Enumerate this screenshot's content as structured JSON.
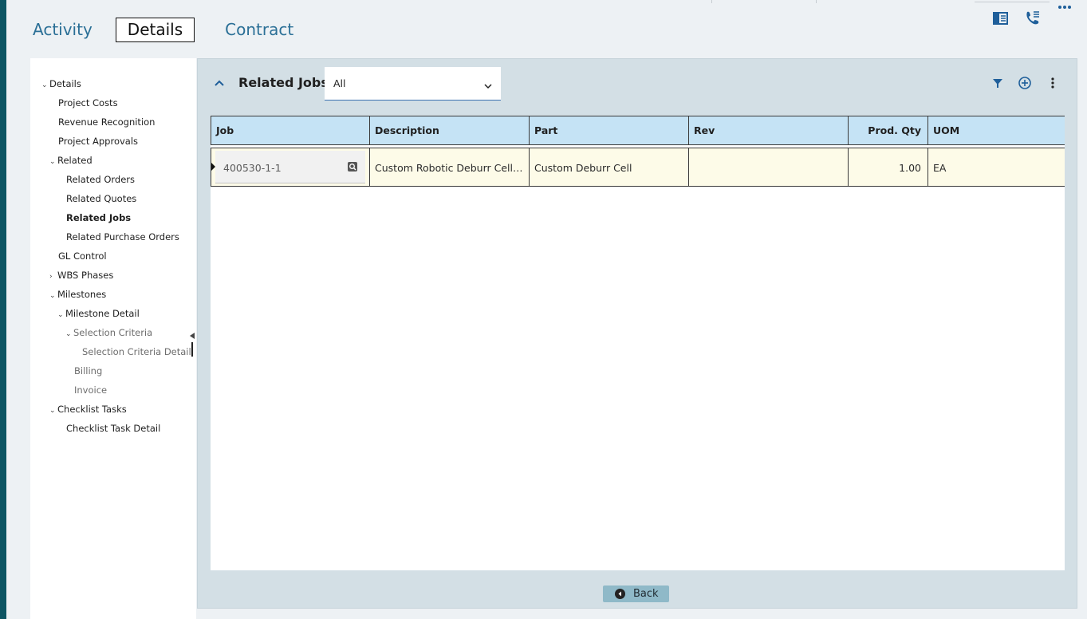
{
  "tabs": [
    {
      "label": "Activity"
    },
    {
      "label": "Details",
      "active": true
    },
    {
      "label": "Contract"
    }
  ],
  "top_icons": [
    "panel-layout-icon",
    "phone-list-icon",
    "more-horizontal-icon"
  ],
  "sidebar": {
    "items": [
      {
        "label": "Details",
        "chevron": "down"
      },
      {
        "label": "Project Costs"
      },
      {
        "label": "Revenue Recognition"
      },
      {
        "label": "Project Approvals"
      },
      {
        "label": "Related",
        "chevron": "down"
      },
      {
        "label": "Related Orders"
      },
      {
        "label": "Related Quotes"
      },
      {
        "label": "Related Jobs",
        "selected": true
      },
      {
        "label": "Related Purchase Orders"
      },
      {
        "label": "GL Control"
      },
      {
        "label": "WBS Phases",
        "chevron": "right"
      },
      {
        "label": "Milestones",
        "chevron": "down"
      },
      {
        "label": "Milestone Detail",
        "chevron": "down"
      },
      {
        "label": "Selection Criteria",
        "chevron": "down",
        "dim": true
      },
      {
        "label": "Selection Criteria Detail",
        "dim": true
      },
      {
        "label": "Billing",
        "dim": true
      },
      {
        "label": "Invoice",
        "dim": true
      },
      {
        "label": "Checklist Tasks",
        "chevron": "down"
      },
      {
        "label": "Checklist Task Detail"
      }
    ]
  },
  "panel": {
    "title": "Related Jobs",
    "filter": {
      "value": "All"
    },
    "header_icons": [
      "filter-icon",
      "add-circle-icon",
      "more-vertical-icon"
    ]
  },
  "grid": {
    "columns": [
      {
        "label": "Job"
      },
      {
        "label": "Description"
      },
      {
        "label": "Part"
      },
      {
        "label": "Rev"
      },
      {
        "label": "Prod. Qty",
        "align": "right"
      },
      {
        "label": "UOM"
      }
    ],
    "rows": [
      {
        "job": "400530-1-1",
        "description": "Custom Robotic Deburr Cell w...",
        "part": "Custom Deburr Cell",
        "rev": "",
        "prod_qty": "1.00",
        "uom": "EA"
      }
    ]
  },
  "back_button": {
    "label": "Back"
  },
  "colors": {
    "accent": "#2a6f96",
    "left_strip": "#0d5563",
    "header_cell": "#c5e3f5",
    "row_bg": "#fdfbe8",
    "panel_bg": "#d3dfe5",
    "back_button_bg": "#8fb9c8"
  }
}
